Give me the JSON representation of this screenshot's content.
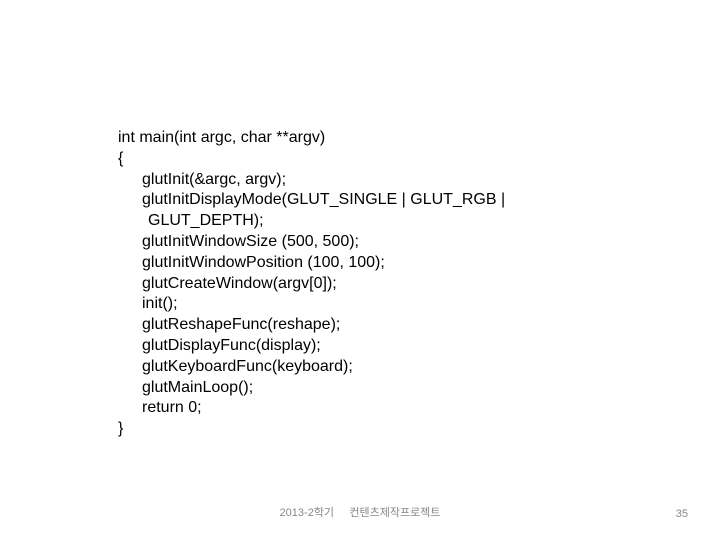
{
  "code": {
    "l0": "int main(int argc, char **argv)",
    "l1": "{",
    "l2": "glutInit(&argc, argv);",
    "l3": "glutInitDisplayMode(GLUT_SINGLE | GLUT_RGB |",
    "l3b": "GLUT_DEPTH);",
    "l4": "glutInitWindowSize (500, 500);",
    "l5": "glutInitWindowPosition (100, 100);",
    "l6": "glutCreateWindow(argv[0]);",
    "l7": "init();",
    "l8": "glutReshapeFunc(reshape);",
    "l9": "glutDisplayFunc(display);",
    "l10": "glutKeyboardFunc(keyboard);",
    "l11": "glutMainLoop();",
    "l12": "return 0;",
    "l13": "}"
  },
  "footer": {
    "left": "2013-2학기",
    "right": "컨텐츠제작프로젝트"
  },
  "page_number": "35"
}
